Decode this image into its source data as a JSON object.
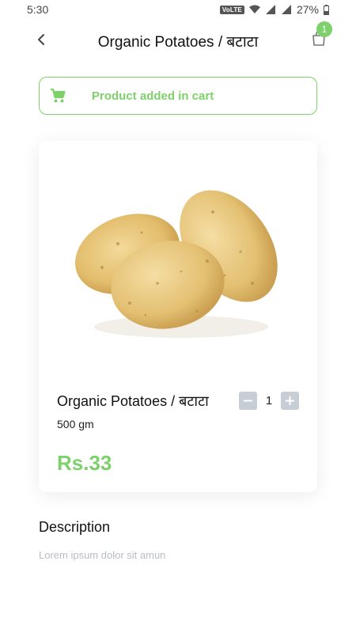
{
  "status_bar": {
    "time": "5:30",
    "network_badge": "VoLTE",
    "battery": "27%"
  },
  "header": {
    "title": "Organic Potatoes / बटाटा",
    "cart_count": "1"
  },
  "toast": {
    "message": "Product added in cart",
    "icon": "cart-icon"
  },
  "product": {
    "name": "Organic Potatoes / बटाटा",
    "weight": "500 gm",
    "price": "Rs.33",
    "quantity": "1"
  },
  "description": {
    "title": "Description",
    "text": "Lorem ipsum dolor sit amun"
  },
  "colors": {
    "accent": "#7ed06b",
    "stepper": "#c8ced6",
    "muted_text": "#b8bcc3"
  }
}
